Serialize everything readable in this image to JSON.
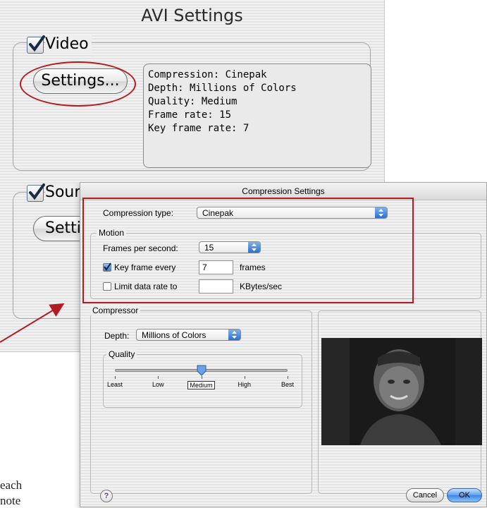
{
  "avi_window": {
    "title": "AVI Settings",
    "video_group": {
      "label": "Video",
      "checked": true,
      "settings_button": "Settings..."
    },
    "summary_lines": [
      "Compression: Cinepak",
      "Depth: Millions of Colors",
      "Quality: Medium",
      "Frame rate: 15",
      "Key frame rate: 7"
    ],
    "sound_group": {
      "label": "Sour",
      "checked": true,
      "settings_button": "Setti"
    }
  },
  "compression_window": {
    "title": "Compression Settings",
    "compression_type_label": "Compression type:",
    "compression_type_value": "Cinepak",
    "motion_label": "Motion",
    "fps_label": "Frames per second:",
    "fps_value": "15",
    "key_frame_label": "Key frame every",
    "key_frame_checked": true,
    "key_frame_value": "7",
    "key_frame_unit": "frames",
    "limit_rate_label": "Limit data rate to",
    "limit_rate_checked": false,
    "limit_rate_value": "",
    "limit_rate_unit": "KBytes/sec",
    "compressor_label": "Compressor",
    "depth_label": "Depth:",
    "depth_value": "Millions of Colors",
    "quality_label": "Quality",
    "quality_ticks": [
      "Least",
      "Low",
      "Medium",
      "High",
      "Best"
    ],
    "quality_selected": "Medium",
    "quality_level": 0.5,
    "help_button": "?",
    "cancel_button": "Cancel",
    "ok_button": "OK"
  },
  "background_text": {
    "line1": "each",
    "line2": "note"
  },
  "colors": {
    "annotation_red": "#b01c22",
    "accent_blue": "#3d86e6"
  }
}
